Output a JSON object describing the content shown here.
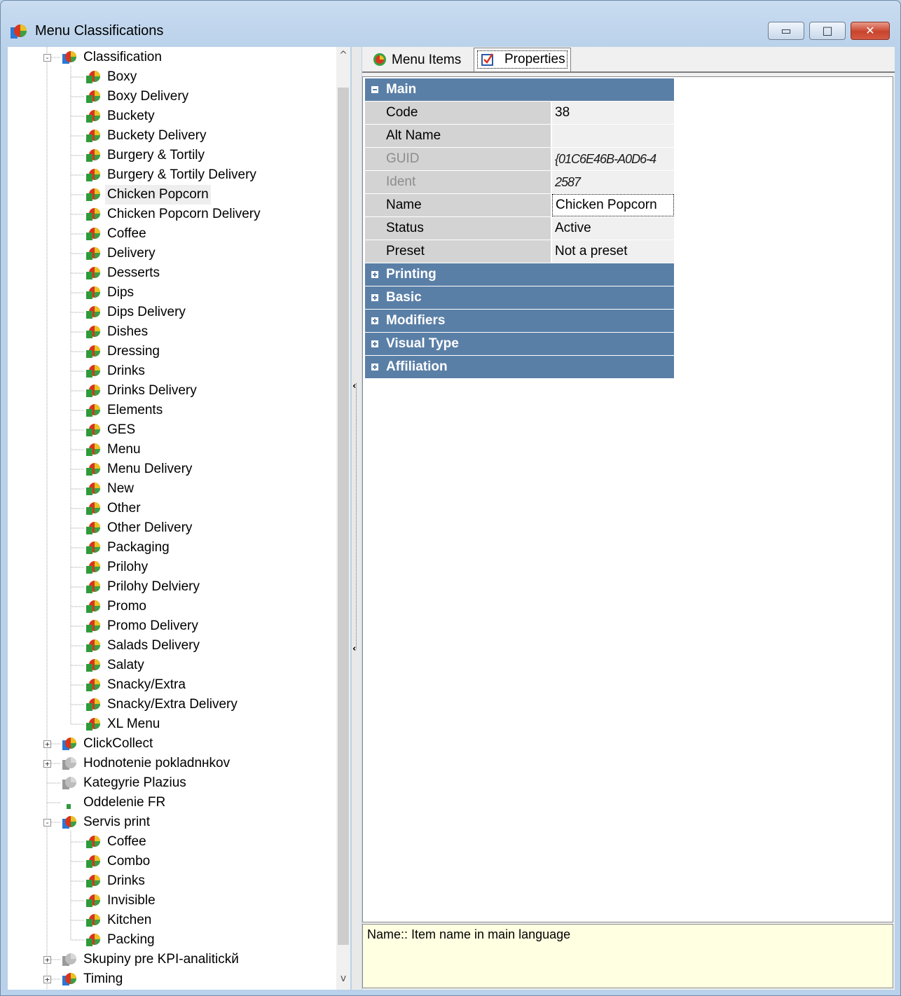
{
  "window": {
    "title": "Menu Classifications",
    "buttons": {
      "minimize": "▭",
      "maximize": "□",
      "close": "✕"
    }
  },
  "tree": {
    "selected": "Chicken Popcorn",
    "scroll_up": "^",
    "scroll_down": "v",
    "nodes": [
      {
        "label": "Classification",
        "level": 0,
        "expander": "-",
        "icon": "folder-book-icon"
      },
      {
        "label": "Boxy",
        "level": 1,
        "icon": "book-icon"
      },
      {
        "label": "Boxy Delivery",
        "level": 1,
        "icon": "book-icon"
      },
      {
        "label": "Buckety",
        "level": 1,
        "icon": "book-icon"
      },
      {
        "label": "Buckety Delivery",
        "level": 1,
        "icon": "book-icon"
      },
      {
        "label": "Burgery & Tortily",
        "level": 1,
        "icon": "book-icon"
      },
      {
        "label": "Burgery & Tortily Delivery",
        "level": 1,
        "icon": "book-icon"
      },
      {
        "label": "Chicken Popcorn",
        "level": 1,
        "icon": "book-icon"
      },
      {
        "label": "Chicken Popcorn Delivery",
        "level": 1,
        "icon": "book-icon"
      },
      {
        "label": "Coffee",
        "level": 1,
        "icon": "book-icon"
      },
      {
        "label": "Delivery",
        "level": 1,
        "icon": "book-icon"
      },
      {
        "label": "Desserts",
        "level": 1,
        "icon": "book-icon"
      },
      {
        "label": "Dips",
        "level": 1,
        "icon": "book-icon"
      },
      {
        "label": "Dips Delivery",
        "level": 1,
        "icon": "book-icon"
      },
      {
        "label": "Dishes",
        "level": 1,
        "icon": "book-icon"
      },
      {
        "label": "Dressing",
        "level": 1,
        "icon": "book-icon"
      },
      {
        "label": "Drinks",
        "level": 1,
        "icon": "book-icon"
      },
      {
        "label": "Drinks Delivery",
        "level": 1,
        "icon": "book-icon"
      },
      {
        "label": "Elements",
        "level": 1,
        "icon": "book-icon"
      },
      {
        "label": "GES",
        "level": 1,
        "icon": "book-icon"
      },
      {
        "label": "Menu",
        "level": 1,
        "icon": "book-icon"
      },
      {
        "label": "Menu Delivery",
        "level": 1,
        "icon": "book-icon"
      },
      {
        "label": "New",
        "level": 1,
        "icon": "book-icon"
      },
      {
        "label": "Other",
        "level": 1,
        "icon": "book-icon"
      },
      {
        "label": "Other Delivery",
        "level": 1,
        "icon": "book-icon"
      },
      {
        "label": "Packaging",
        "level": 1,
        "icon": "book-icon"
      },
      {
        "label": "Prilohy",
        "level": 1,
        "icon": "book-icon"
      },
      {
        "label": "Prilohy Delviery",
        "level": 1,
        "icon": "book-icon"
      },
      {
        "label": "Promo",
        "level": 1,
        "icon": "book-icon"
      },
      {
        "label": "Promo Delivery",
        "level": 1,
        "icon": "book-icon"
      },
      {
        "label": "Salads Delivery",
        "level": 1,
        "icon": "book-icon"
      },
      {
        "label": "Salaty",
        "level": 1,
        "icon": "book-icon"
      },
      {
        "label": "Snacky/Extra",
        "level": 1,
        "icon": "book-icon"
      },
      {
        "label": "Snacky/Extra Delivery",
        "level": 1,
        "icon": "book-icon"
      },
      {
        "label": "XL Menu",
        "level": 1,
        "icon": "book-icon"
      },
      {
        "label": "ClickCollect",
        "level": 0,
        "expander": "+",
        "icon": "folder-book-icon"
      },
      {
        "label": "Hodnotenie pokladnнkov",
        "level": 0,
        "expander": "+",
        "icon": "gray-book-icon"
      },
      {
        "label": "Kategyrie Plazius",
        "level": 0,
        "icon": "gray-book-icon"
      },
      {
        "label": "Oddelenie FR",
        "level": 0,
        "icon": "small-green-icon"
      },
      {
        "label": "Servis print",
        "level": 0,
        "expander": "-",
        "icon": "folder-book-icon"
      },
      {
        "label": "Coffee",
        "level": 1,
        "icon": "book-icon"
      },
      {
        "label": "Combo",
        "level": 1,
        "icon": "book-icon"
      },
      {
        "label": "Drinks",
        "level": 1,
        "icon": "book-icon"
      },
      {
        "label": "Invisible",
        "level": 1,
        "icon": "book-icon"
      },
      {
        "label": "Kitchen",
        "level": 1,
        "icon": "book-icon"
      },
      {
        "label": "Packing",
        "level": 1,
        "icon": "book-icon"
      },
      {
        "label": "Skupiny pre KPI-analitickй",
        "level": 0,
        "expander": "+",
        "icon": "gray-book-icon"
      },
      {
        "label": "Timing",
        "level": 0,
        "expander": "+",
        "icon": "folder-book-icon"
      }
    ]
  },
  "tabs": [
    {
      "label": "Menu Items",
      "icon": "menu-items-icon"
    },
    {
      "label": "Properties",
      "icon": "properties-checkbox-icon",
      "active": true
    }
  ],
  "properties": {
    "sections": [
      {
        "title": "Main",
        "expanded": true,
        "rows": [
          {
            "name": "Code",
            "value": "38"
          },
          {
            "name": "Alt Name",
            "value": ""
          },
          {
            "name": "GUID",
            "value": "{01C6E46B-A0D6-4",
            "readonly": true
          },
          {
            "name": "Ident",
            "value": "2587",
            "readonly": true
          },
          {
            "name": "Name",
            "value": "Chicken Popcorn",
            "focused": true
          },
          {
            "name": "Status",
            "value": "Active"
          },
          {
            "name": "Preset",
            "value": "Not a preset"
          }
        ]
      },
      {
        "title": "Printing",
        "expanded": false
      },
      {
        "title": "Basic",
        "expanded": false
      },
      {
        "title": "Modifiers",
        "expanded": false
      },
      {
        "title": "Visual Type",
        "expanded": false
      },
      {
        "title": "Affiliation",
        "expanded": false
      }
    ],
    "description": "Name:: Item name in main language"
  },
  "colors": {
    "section_header": "#5a7fa7",
    "description_bg": "#ffffe1",
    "window_frame": "#b9d1ea"
  }
}
